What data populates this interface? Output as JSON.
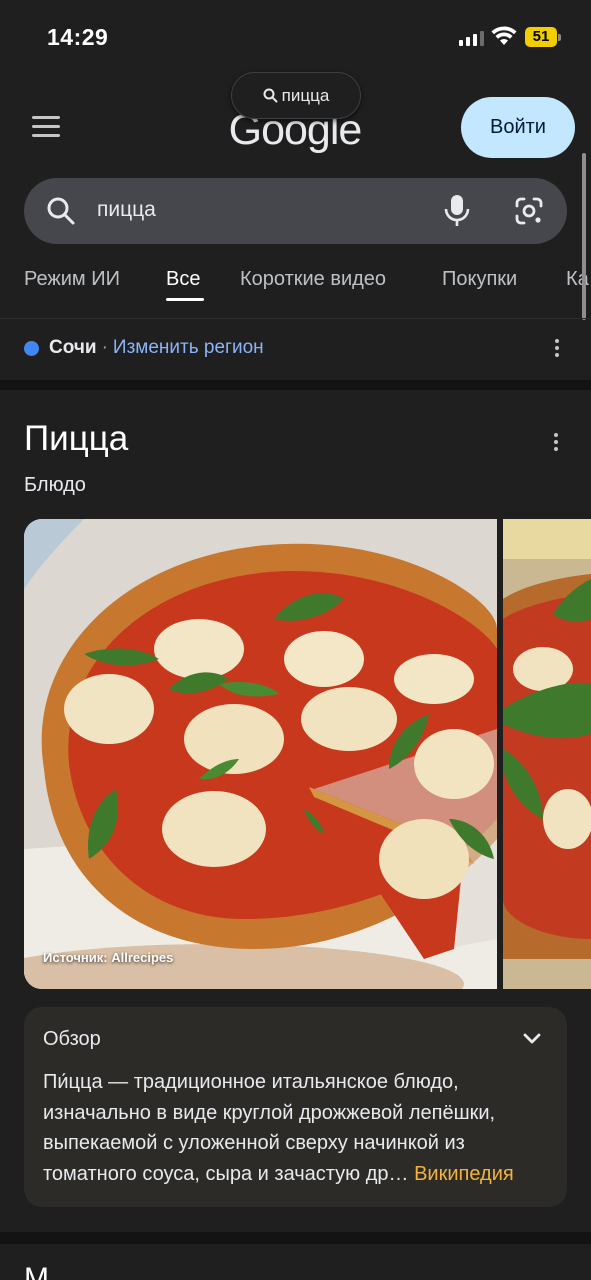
{
  "status": {
    "time": "14:29",
    "battery": "51"
  },
  "header": {
    "pill_query": "пицца",
    "logo": "Google",
    "login": "Войти"
  },
  "search": {
    "query": "пицца"
  },
  "tabs": [
    "Режим ИИ",
    "Все",
    "Короткие видео",
    "Покупки",
    "Ка"
  ],
  "active_tab": "Все",
  "location": {
    "city": "Сочи",
    "separator": "·",
    "change": "Изменить регион"
  },
  "knowledge_panel": {
    "title": "Пицца",
    "subtitle": "Блюдо",
    "image_caption": "Источник: Allrecipes"
  },
  "overview": {
    "title": "Обзор",
    "text": "Пи́цца — традиционное итальянское блюдо, изначально в виде круглой дрожжевой лепёшки, выпекаемой с уложенной сверху начинкой из томатного соуса, сыра и зачастую др…",
    "source": "Википедия"
  },
  "next_section_title": "М",
  "colors": {
    "background": "#1f1f1f",
    "login_button": "#c2e7ff",
    "link": "#8ab4f8",
    "source_link": "#f2b23e",
    "location_dot": "#4285f4",
    "battery": "#f2cd00"
  }
}
